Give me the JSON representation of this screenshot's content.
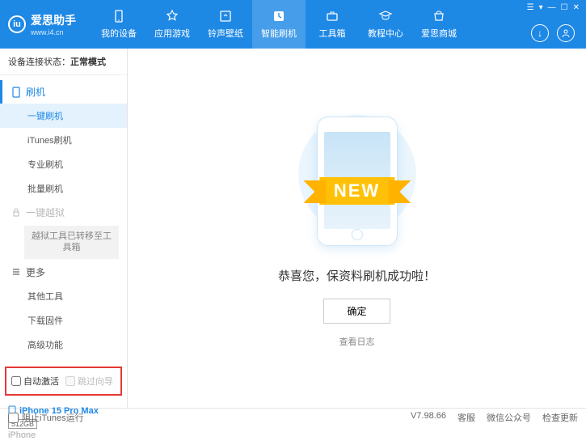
{
  "header": {
    "logo_title": "爱思助手",
    "logo_sub": "www.i4.cn",
    "nav": [
      {
        "label": "我的设备"
      },
      {
        "label": "应用游戏"
      },
      {
        "label": "铃声壁纸"
      },
      {
        "label": "智能刷机"
      },
      {
        "label": "工具箱"
      },
      {
        "label": "教程中心"
      },
      {
        "label": "爱思商城"
      }
    ]
  },
  "status": {
    "label": "设备连接状态：",
    "value": "正常模式"
  },
  "sidebar": {
    "flash_header": "刷机",
    "flash_items": [
      "一键刷机",
      "iTunes刷机",
      "专业刷机",
      "批量刷机"
    ],
    "jailbreak_header": "一键越狱",
    "jailbreak_note": "越狱工具已转移至工具箱",
    "more_header": "更多",
    "more_items": [
      "其他工具",
      "下载固件",
      "高级功能"
    ],
    "cb_auto": "自动激活",
    "cb_skip": "跳过向导",
    "device_name": "iPhone 15 Pro Max",
    "device_storage": "512GB",
    "device_type": "iPhone"
  },
  "main": {
    "ribbon": "NEW",
    "success": "恭喜您，保资料刷机成功啦！",
    "ok": "确定",
    "log": "查看日志"
  },
  "footer": {
    "block_itunes": "阻止iTunes运行",
    "version": "V7.98.66",
    "links": [
      "客服",
      "微信公众号",
      "检查更新"
    ]
  }
}
